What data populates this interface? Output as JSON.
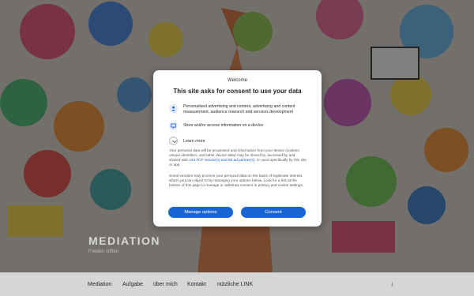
{
  "site": {
    "title": "MEDIATION",
    "tagline": "Frieden stiften"
  },
  "nav": {
    "items": [
      "Mediation",
      "Aufgabe",
      "über mich",
      "Kontakt",
      "nützliche LINK"
    ],
    "scroll_icon": "arrow-down-icon",
    "scroll_glyph": "↓"
  },
  "consent": {
    "welcome": "Welcome",
    "title": "This site asks for consent to use your data",
    "purposes": [
      {
        "icon": "person-icon",
        "text": "Personalised advertising and content, advertising and content measurement, audience research and services development"
      },
      {
        "icon": "device-icon",
        "text": "Store and/or access information on a device"
      }
    ],
    "learn_more": "Learn more",
    "body1_pre": "Your personal data will be processed and information from your device (cookies, unique identifiers, and other device data) may be stored by, accessed by and shared with ",
    "body1_link": "133 TCF vendor(s) and 65 ad partner(s)",
    "body1_post": ", or used specifically by this site or app.",
    "body2": "Some vendors may process your personal data on the basis of legitimate interest, which you can object to by managing your options below. Look for a link at the bottom of this page to manage or withdraw consent in privacy and cookie settings.",
    "manage_label": "Manage options",
    "consent_label": "Consent"
  },
  "colors": {
    "accent": "#1a65d6",
    "link": "#1a5bd6"
  }
}
